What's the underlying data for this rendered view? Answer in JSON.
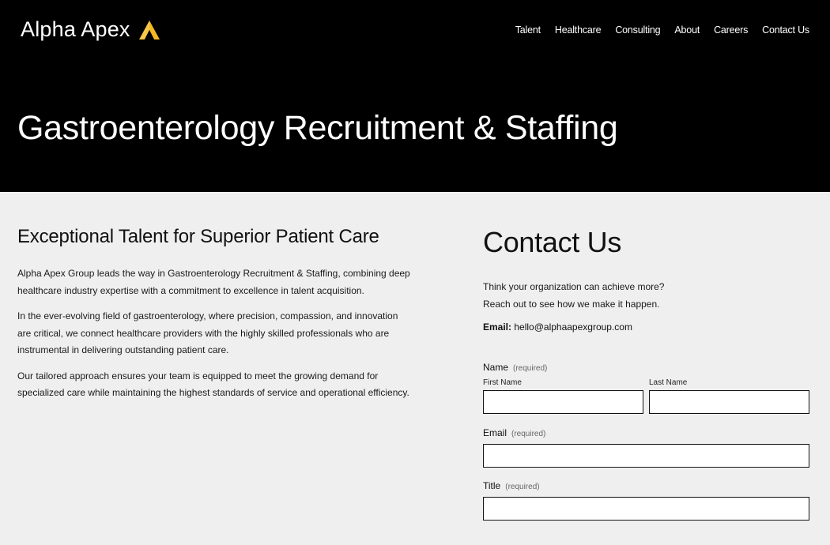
{
  "header": {
    "logo_text": "Alpha Apex",
    "logo_icon": "apex-triangle-icon",
    "accent_color": "#f5b823",
    "nav": [
      "Talent",
      "Healthcare",
      "Consulting",
      "About",
      "Careers",
      "Contact Us"
    ]
  },
  "hero": {
    "title": "Gastroenterology Recruitment & Staffing"
  },
  "intro": {
    "heading": "Exceptional Talent for Superior Patient Care",
    "paragraphs": [
      "Alpha Apex Group leads the way in Gastroenterology Recruitment & Staffing, combining deep healthcare industry expertise with a commitment to excellence in talent acquisition.",
      "In the ever-evolving field of gastroenterology, where precision, compassion, and innovation are critical, we connect healthcare providers with the highly skilled professionals who are instrumental in delivering outstanding patient care.",
      "Our tailored approach ensures your team is equipped to meet the growing demand for specialized care while maintaining the highest standards of service and operational efficiency."
    ]
  },
  "contact": {
    "heading": "Contact Us",
    "tagline_1": "Think your organization can achieve more?",
    "tagline_2": "Reach out to see how we make it happen.",
    "email_label": "Email:",
    "email_value": "hello@alphaapexgroup.com",
    "form": {
      "name_label": "Name",
      "name_required": "(required)",
      "first_name_label": "First Name",
      "first_name_value": "",
      "last_name_label": "Last Name",
      "last_name_value": "",
      "email_label": "Email",
      "email_required": "(required)",
      "email_value": "",
      "title_label": "Title",
      "title_required": "(required)",
      "title_value": ""
    }
  }
}
